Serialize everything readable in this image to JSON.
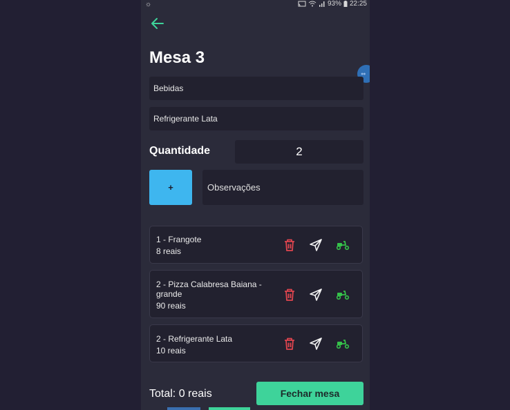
{
  "status_bar": {
    "battery": "93%",
    "time": "22:25"
  },
  "header": {
    "title": "Mesa 3"
  },
  "form": {
    "category_value": "Bebidas",
    "product_value": "Refrigerante Lata",
    "quantity_label": "Quantidade",
    "quantity_value": "2",
    "add_label": "+",
    "observations_placeholder": "Observações"
  },
  "orders": [
    {
      "name": "1 - Frangote",
      "price": "8 reais"
    },
    {
      "name": "2 - Pizza Calabresa Baiana - grande",
      "price": "90 reais"
    },
    {
      "name": "2 - Refrigerante Lata",
      "price": "10 reais"
    }
  ],
  "footer": {
    "total": "Total: 0 reais",
    "close_label": "Fechar mesa"
  },
  "colors": {
    "background": "#221f33",
    "surface": "#2b2b3a",
    "input": "#22212f",
    "accent_blue": "#3eb6ef",
    "accent_green": "#3ed39a",
    "delete_red": "#e0454f",
    "delivery_green": "#35c24a"
  },
  "icons": {
    "back": "arrow-left-icon",
    "delete": "trash-icon",
    "send": "send-icon",
    "delivery": "scooter-icon"
  }
}
